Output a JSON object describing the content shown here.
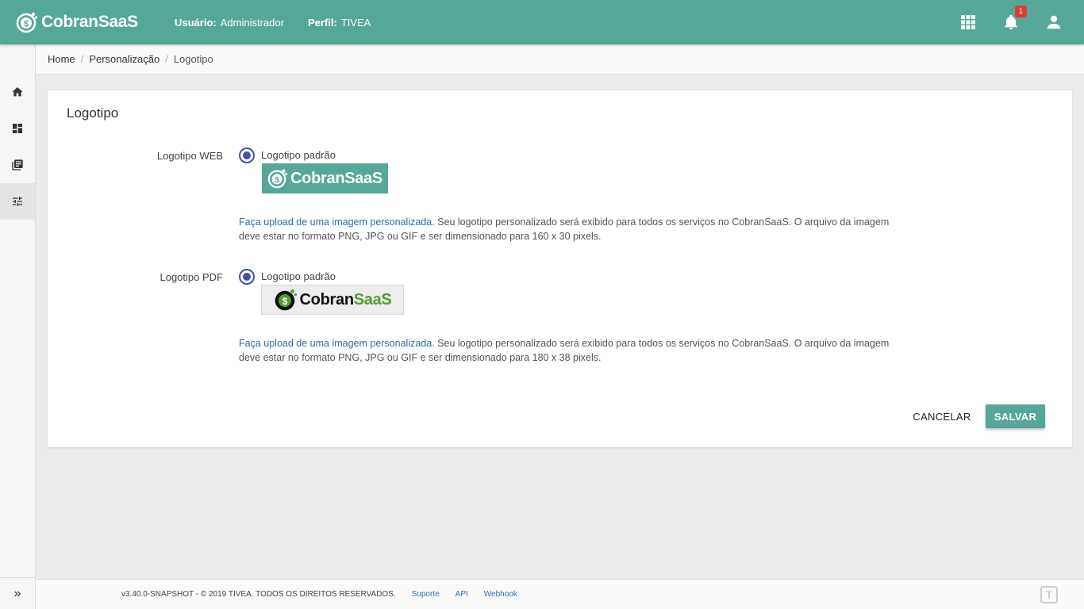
{
  "app": {
    "brand": "CobranSaaS",
    "user_label": "Usuário:",
    "user_value": "Administrador",
    "profile_label": "Perfil:",
    "profile_value": "TIVEA",
    "notification_count": "1",
    "accent_color": "#55a898"
  },
  "breadcrumb": {
    "home": "Home",
    "section": "Personalização",
    "current": "Logotipo",
    "separator": "/"
  },
  "sidebar": {
    "items": [
      {
        "icon": "home-icon"
      },
      {
        "icon": "dashboard-icon"
      },
      {
        "icon": "library-icon"
      },
      {
        "icon": "tune-icon",
        "active": true
      }
    ],
    "expand": "»"
  },
  "page": {
    "title": "Logotipo",
    "web": {
      "label": "Logotipo WEB",
      "option": "Logotipo padrão",
      "logo_text": "CobranSaaS",
      "upload_link": "Faça upload de uma imagem personalizada.",
      "help": " Seu logotipo personalizado será exibido para todos os serviços no CobranSaaS. O arquivo da imagem deve estar no formato PNG, JPG ou GIF e ser dimensionado para 160 x 30 pixels."
    },
    "pdf": {
      "label": "Logotipo PDF",
      "option": "Logotipo padrão",
      "logo_text_1": "Cobran",
      "logo_text_2": "SaaS",
      "upload_link": "Faça upload de uma imagem personalizada.",
      "help": " Seu logotipo personalizado será exibido para todos os serviços no CobranSaaS. O arquivo da imagem deve estar no formato PNG, JPG ou GIF e ser dimensionado para 180 x 38 pixels."
    },
    "cancel_label": "CANCELAR",
    "save_label": "SALVAR"
  },
  "footer": {
    "copyright": "v3.40.0-SNAPSHOT - © 2019 TIVEA. TODOS OS DIREITOS RESERVADOS.",
    "links": [
      "Suporte",
      "API",
      "Webhook"
    ],
    "mark": "T"
  }
}
